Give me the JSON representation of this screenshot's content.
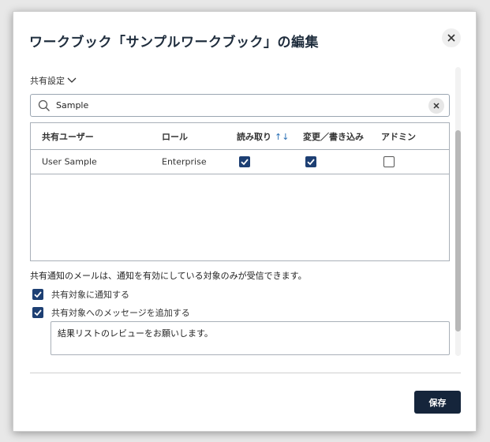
{
  "dialog": {
    "title": "ワークブック「サンプルワークブック」の編集",
    "share_settings_label": "共有設定",
    "search": {
      "value": "Sample",
      "placeholder": ""
    },
    "table": {
      "headers": [
        "共有ユーザー",
        "ロール",
        "読み取り",
        "変更／書き込み",
        "アドミン"
      ],
      "rows": [
        {
          "user": "User Sample",
          "role": "Enterprise",
          "read": true,
          "write": true,
          "admin": false
        }
      ]
    },
    "notice": "共有通知のメールは、通知を有効にしている対象のみが受信できます。",
    "options": [
      {
        "label": "共有対象に通知する",
        "checked": true
      },
      {
        "label": "共有対象へのメッセージを追加する",
        "checked": true
      }
    ],
    "message": "結果リストのレビューをお願いします。",
    "save_label": "保存"
  },
  "colors": {
    "accent": "#1d3f73",
    "primary_button": "#15253b",
    "sort_icon": "#2a6fb5"
  }
}
